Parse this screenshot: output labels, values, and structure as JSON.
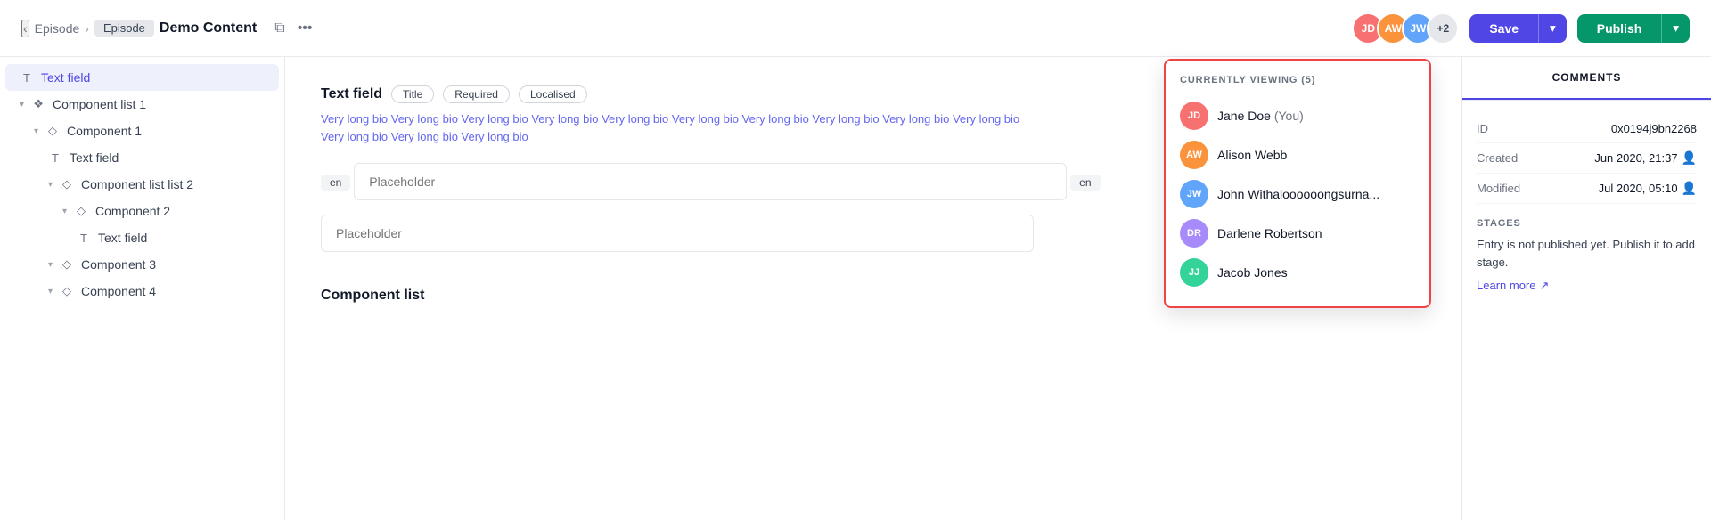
{
  "header": {
    "back_icon": "‹",
    "breadcrumb": {
      "item1": "Episode",
      "sep": ">",
      "tag": "Episode",
      "current": "Demo Content"
    },
    "copy_icon": "⧉",
    "more_icon": "···",
    "save_label": "Save",
    "publish_label": "Publish",
    "avatar_count": "+2"
  },
  "viewing_dropdown": {
    "title": "CURRENTLY VIEWING (5)",
    "users": [
      {
        "name": "Jane Doe",
        "suffix": "(You)",
        "color": "av-1",
        "initials": "JD"
      },
      {
        "name": "Alison Webb",
        "suffix": "",
        "color": "av-2",
        "initials": "AW"
      },
      {
        "name": "John Withaloooooongsurna...",
        "suffix": "",
        "color": "av-3",
        "initials": "JW"
      },
      {
        "name": "Darlene Robertson",
        "suffix": "",
        "color": "av-4",
        "initials": "DR"
      },
      {
        "name": "Jacob Jones",
        "suffix": "",
        "color": "av-5",
        "initials": "JJ"
      }
    ]
  },
  "sidebar": {
    "items": [
      {
        "id": "text-field-root",
        "label": "Text field",
        "icon": "T",
        "indent": 0,
        "active": true,
        "chevron": ""
      },
      {
        "id": "component-list-1",
        "label": "Component list 1",
        "icon": "❖",
        "indent": 0,
        "active": false,
        "chevron": "▾"
      },
      {
        "id": "component-1",
        "label": "Component 1",
        "icon": "◇",
        "indent": 1,
        "active": false,
        "chevron": "▾"
      },
      {
        "id": "text-field-1",
        "label": "Text field",
        "icon": "T",
        "indent": 2,
        "active": false,
        "chevron": ""
      },
      {
        "id": "component-list-list-2",
        "label": "Component list list 2",
        "icon": "◇",
        "indent": 2,
        "active": false,
        "chevron": "▾"
      },
      {
        "id": "component-2",
        "label": "Component 2",
        "icon": "◇",
        "indent": 3,
        "active": false,
        "chevron": "▾"
      },
      {
        "id": "text-field-2",
        "label": "Text field",
        "icon": "T",
        "indent": 4,
        "active": false,
        "chevron": ""
      },
      {
        "id": "component-3",
        "label": "Component 3",
        "icon": "◇",
        "indent": 2,
        "active": false,
        "chevron": "▾"
      },
      {
        "id": "component-4",
        "label": "Component 4",
        "icon": "◇",
        "indent": 2,
        "active": false,
        "chevron": "▾"
      }
    ]
  },
  "content": {
    "field_title": "Text field",
    "badge_title": "Title",
    "badge_required": "Required",
    "badge_localised": "Localised",
    "description": "Very long bio Very long bio Very long bio Very long bio Very long bio Very long bio Very long bio Very long bio Very long bio Very long bio Very long bio Very long bio Very long bio",
    "lang_tag_1": "en",
    "placeholder_1": "Placeholder",
    "lang_tag_2": "en",
    "placeholder_2": "Placeholder",
    "component_list_label": "Component list"
  },
  "right_panel": {
    "tabs": [
      {
        "id": "comments",
        "label": "COMMENTS",
        "active": true
      }
    ],
    "info_rows": [
      {
        "label": "ID",
        "value": "0x0194j9bn2268"
      },
      {
        "label": "Created",
        "value": "Jun 2020, 21:37",
        "has_icon": true
      },
      {
        "label": "Modified",
        "value": "Jul 2020, 05:10",
        "has_icon": true
      }
    ],
    "stages": {
      "title": "STAGES",
      "text": "Entry is not published yet. Publish it to add stage.",
      "link": "Learn more"
    }
  }
}
